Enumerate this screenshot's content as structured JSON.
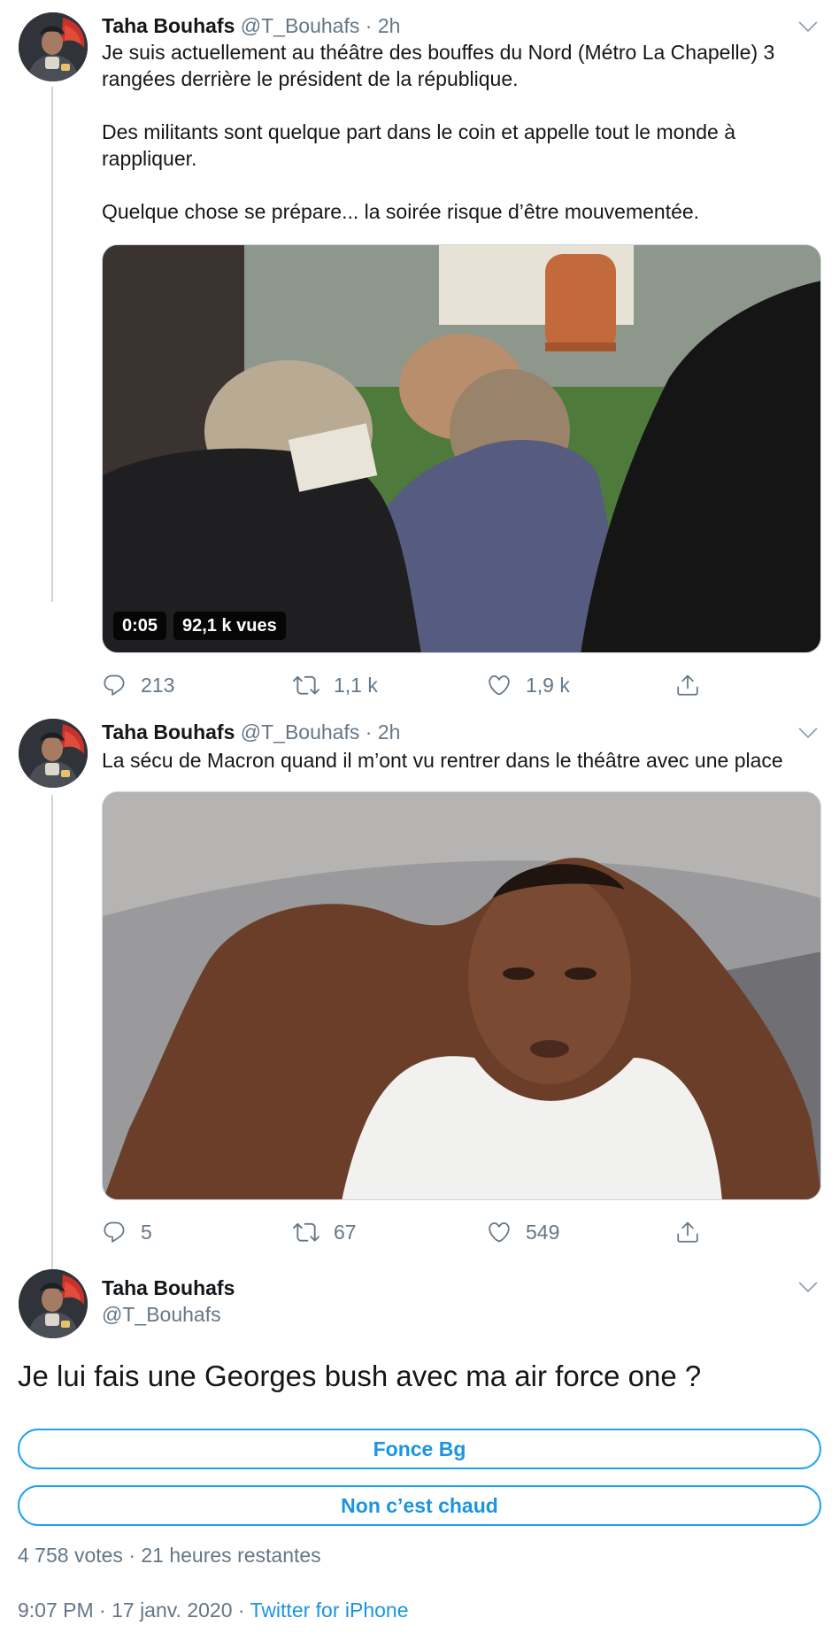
{
  "tweets": [
    {
      "name": "Taha Bouhafs",
      "handle": "@T_Bouhafs",
      "separator": "·",
      "time": "2h",
      "text_lines": [
        "Je suis actuellement au théâtre des bouffes du Nord (Métro La Chapelle) 3 rangées derrière le président de la république.",
        "Des militants sont quelque part dans le coin et appelle tout le monde à rappliquer.",
        "Quelque chose se prépare... la soirée risque d’être mouvementée."
      ],
      "media": {
        "kind": "video",
        "duration": "0:05",
        "views": "92,1 k vues"
      },
      "stats": {
        "replies": "213",
        "retweets": "1,1 k",
        "likes": "1,9 k"
      }
    },
    {
      "name": "Taha Bouhafs",
      "handle": "@T_Bouhafs",
      "separator": "·",
      "time": "2h",
      "text_lines": [
        "La sécu de Macron quand il m’ont vu rentrer dans le théâtre avec une place"
      ],
      "media": {
        "kind": "image"
      },
      "stats": {
        "replies": "5",
        "retweets": "67",
        "likes": "549"
      }
    }
  ],
  "main_tweet": {
    "name": "Taha Bouhafs",
    "handle": "@T_Bouhafs",
    "text": "Je lui fais une Georges bush avec ma air force one ?",
    "poll": {
      "options": [
        "Fonce Bg",
        "Non c’est chaud"
      ],
      "votes": "4 758 votes",
      "separator": "·",
      "remaining": "21 heures restantes"
    },
    "timestamp": "9:07 PM · 17 janv. 2020",
    "separator": "·",
    "source": "Twitter for iPhone"
  },
  "icons": {
    "reply": "reply-icon",
    "retweet": "retweet-icon",
    "like": "heart-icon",
    "share": "share-icon",
    "menu": "chevron-down-icon"
  },
  "colors": {
    "accent": "#1da1f2",
    "link": "#1b95e0",
    "muted": "#657786",
    "text": "#14171a",
    "border": "#ccd6dd"
  }
}
